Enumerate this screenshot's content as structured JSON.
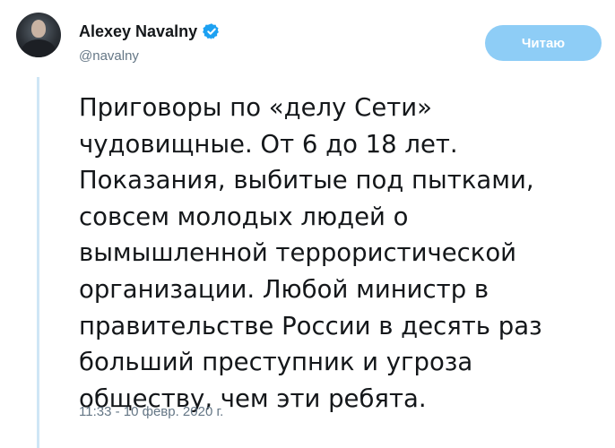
{
  "author": {
    "display_name": "Alexey Navalny",
    "handle": "@navalny",
    "verified": true,
    "verified_color": "#1da1f2"
  },
  "follow_button": {
    "label": "Читаю",
    "color": "#8ecdf6"
  },
  "tweet": {
    "lines": [
      "Приговоры по «делу Сети»",
      "чудовищные. От 6 до 18 лет.",
      "Показания, выбитые под пытками,",
      "совсем молодых людей о",
      "вымышленной террористической",
      "организации. Любой министр в",
      "правительстве России в десять раз",
      "больший преступник и угроза",
      "обществу, чем эти ребята."
    ],
    "timestamp": "11:33 - 10 февр. 2020 г."
  },
  "icons": {
    "verified": "verified-badge-icon",
    "avatar": "profile-photo"
  },
  "colors": {
    "text": "#14171a",
    "secondary_text": "#657786",
    "thread_line": "#cfe6f6"
  }
}
